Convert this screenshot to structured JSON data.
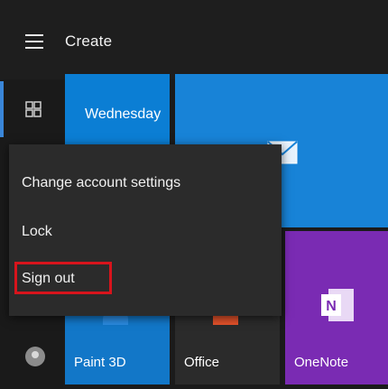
{
  "header": {
    "title": "Create"
  },
  "tiles": {
    "calendar": {
      "day": "Wednesday"
    },
    "paint3d": {
      "label": "Paint 3D"
    },
    "office": {
      "label": "Office"
    },
    "onenote": {
      "label": "OneNote"
    }
  },
  "account_menu": {
    "items": [
      "Change account settings",
      "Lock",
      "Sign out"
    ],
    "highlighted_item": "Sign out",
    "highlight_color": "#d7141c"
  },
  "colors": {
    "accent": "#0b7ed4",
    "onenote": "#7a2bb3",
    "background": "#1b1b1b"
  }
}
